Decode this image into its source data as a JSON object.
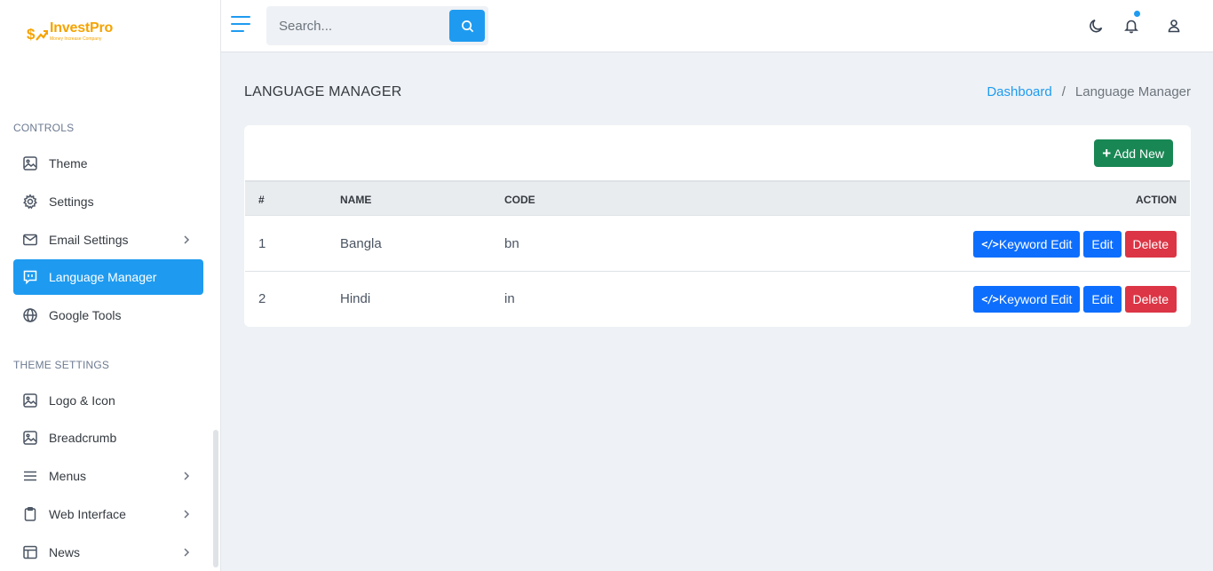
{
  "brand": {
    "name": "InvestPro",
    "tagline": "Money Increase Company",
    "color": "#f5a300"
  },
  "accent": "#1e9bf0",
  "sidebar": {
    "sections": [
      {
        "title": "CONTROLS",
        "items": [
          {
            "label": "Theme",
            "icon": "image-icon"
          },
          {
            "label": "Settings",
            "icon": "gear-icon"
          },
          {
            "label": "Email Settings",
            "icon": "mail-icon",
            "has_submenu": true
          },
          {
            "label": "Language Manager",
            "icon": "chat-icon",
            "active": true
          },
          {
            "label": "Google Tools",
            "icon": "globe-icon"
          }
        ]
      },
      {
        "title": "THEME SETTINGS",
        "items": [
          {
            "label": "Logo & Icon",
            "icon": "image-icon"
          },
          {
            "label": "Breadcrumb",
            "icon": "image-icon"
          },
          {
            "label": "Menus",
            "icon": "menu-icon",
            "has_submenu": true
          },
          {
            "label": "Web Interface",
            "icon": "clipboard-icon",
            "has_submenu": true
          },
          {
            "label": "News",
            "icon": "layout-icon",
            "has_submenu": true
          }
        ]
      }
    ]
  },
  "header": {
    "search": {
      "placeholder": "Search...",
      "value": ""
    },
    "icons": [
      "moon-icon",
      "bell-icon",
      "user-icon"
    ]
  },
  "page": {
    "title": "LANGUAGE MANAGER",
    "breadcrumb": {
      "home": "Dashboard",
      "separator": "/",
      "current": "Language Manager"
    }
  },
  "table": {
    "add_label": "Add New",
    "columns": {
      "index": "#",
      "name": "NAME",
      "code": "CODE",
      "action": "ACTION"
    },
    "rows": [
      {
        "index": "1",
        "name": "Bangla",
        "code": "bn"
      },
      {
        "index": "2",
        "name": "Hindi",
        "code": "in"
      }
    ],
    "actions": {
      "keyword_edit": "Keyword Edit",
      "edit": "Edit",
      "delete": "Delete"
    }
  }
}
